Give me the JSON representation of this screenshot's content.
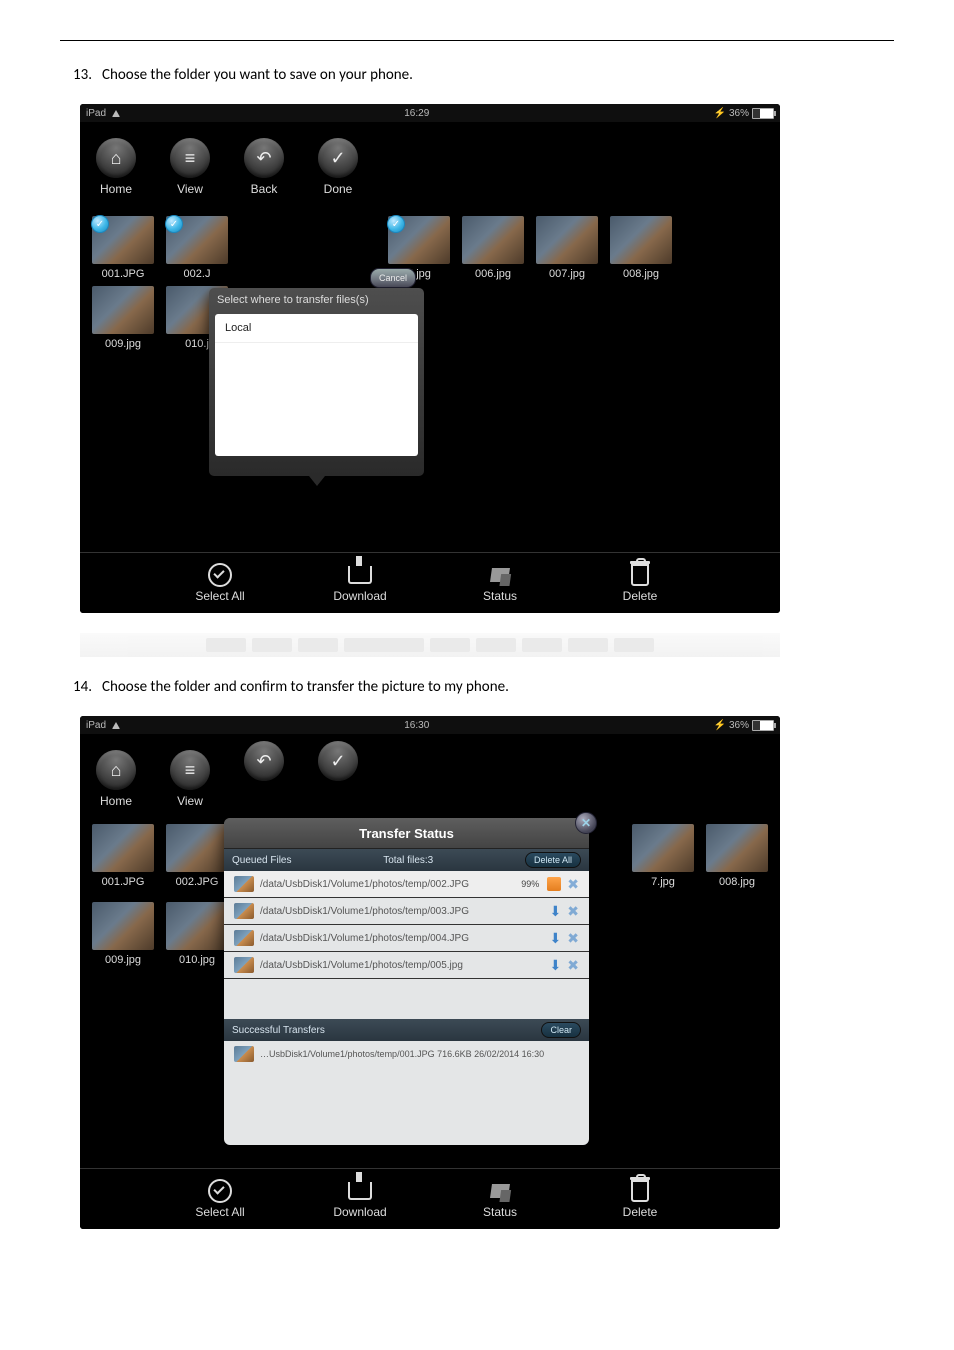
{
  "steps": {
    "s13": {
      "num": "13.",
      "text": "Choose the folder you want to save on your phone."
    },
    "s14": {
      "num": "14.",
      "text": "Choose the folder and confirm to transfer the picture to my phone."
    }
  },
  "statusbar": {
    "device": "iPad",
    "time1": "16:29",
    "time2": "16:30",
    "battery": "36%"
  },
  "topbar": {
    "home": "Home",
    "view": "View",
    "back": "Back",
    "done": "Done"
  },
  "popover": {
    "title": "Select where to transfer files(s)",
    "cancel": "Cancel",
    "item1": "Local"
  },
  "thumbs": {
    "t1": "001.JPG",
    "t2": "002.J",
    "t5": "5.jpg",
    "t6": "006.jpg",
    "t7": "007.jpg",
    "t8": "008.jpg",
    "t9": "009.jpg",
    "t10": "010.j",
    "s2t2": "002.JPG",
    "s2t7": "7.jpg",
    "s2t10": "010.jpg"
  },
  "bottombar": {
    "selectAll": "Select All",
    "download": "Download",
    "status": "Status",
    "delete": "Delete"
  },
  "panel": {
    "title": "Transfer Status",
    "queued": "Queued Files",
    "total": "Total files:3",
    "deleteAll": "Delete All",
    "rows": {
      "r1": "/data/UsbDisk1/Volume1/photos/temp/002.JPG",
      "r2": "/data/UsbDisk1/Volume1/photos/temp/003.JPG",
      "r3": "/data/UsbDisk1/Volume1/photos/temp/004.JPG",
      "r4": "/data/UsbDisk1/Volume1/photos/temp/005.jpg"
    },
    "pct": "99%",
    "successful": "Successful Transfers",
    "clear": "Clear",
    "srow": "…UsbDisk1/Volume1/photos/temp/001.JPG  716.6KB  26/02/2014 16:30"
  }
}
